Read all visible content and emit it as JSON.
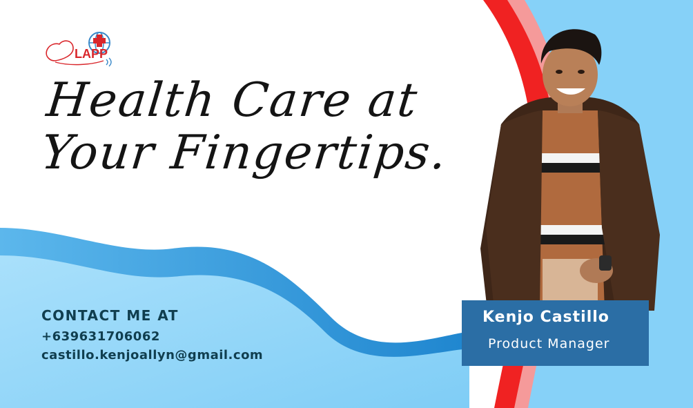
{
  "logo": {
    "text": "LAPP"
  },
  "headline": {
    "line1": "Health Care at",
    "line2": "Your Fingertips."
  },
  "contact": {
    "heading": "CONTACT ME AT",
    "phone": "+639631706062",
    "email": "castillo.kenjoallyn@gmail.com"
  },
  "profile": {
    "name": "Kenjo Castillo",
    "role": "Product Manager"
  },
  "colors": {
    "accent_blue": "#2b6ea5",
    "light_blue": "#8fd3f9",
    "red_stripe": "#f02222",
    "pink_stripe": "#f59a9a",
    "text_dark": "#103e4f"
  }
}
